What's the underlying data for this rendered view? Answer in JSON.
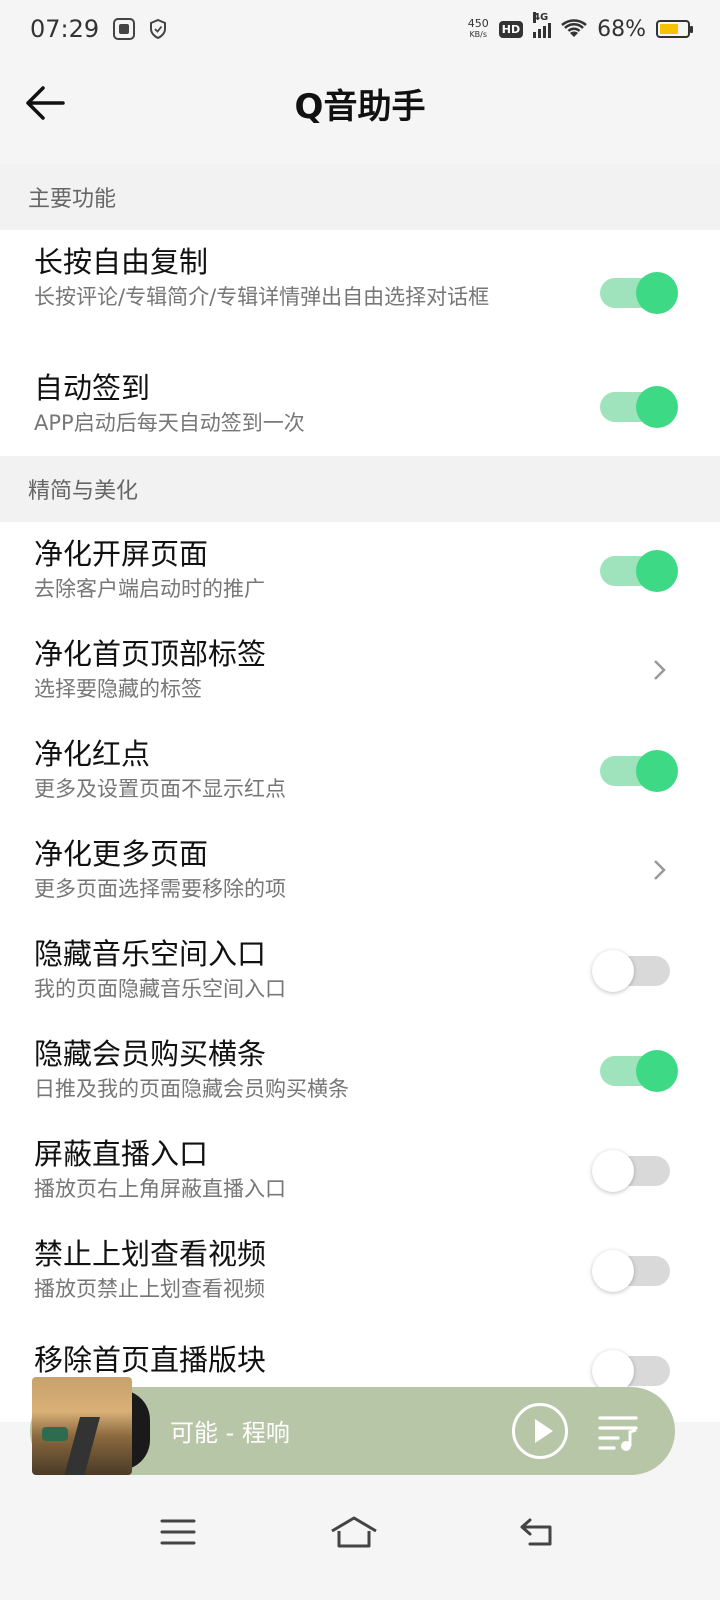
{
  "status_bar": {
    "time": "07:29",
    "net_speed_top": "450",
    "net_speed_bottom": "KB/s",
    "hd": "HD",
    "network": "4G",
    "battery": "68%",
    "battery_level": 0.68,
    "battery_color": "#f7c200"
  },
  "header": {
    "title": "Q音助手",
    "back_icon": "arrow-left-icon"
  },
  "sections": [
    {
      "label": "主要功能",
      "items": [
        {
          "title": "长按自由复制",
          "desc": "长按评论/专辑简介/专辑详情弹出自由选择对话框",
          "control": "toggle",
          "on": true
        },
        {
          "title": "自动签到",
          "desc": "APP启动后每天自动签到一次",
          "control": "toggle",
          "on": true
        }
      ]
    },
    {
      "label": "精简与美化",
      "items": [
        {
          "title": "净化开屏页面",
          "desc": "去除客户端启动时的推广",
          "control": "toggle",
          "on": true
        },
        {
          "title": "净化首页顶部标签",
          "desc": "选择要隐藏的标签",
          "control": "chevron"
        },
        {
          "title": "净化红点",
          "desc": "更多及设置页面不显示红点",
          "control": "toggle",
          "on": true
        },
        {
          "title": "净化更多页面",
          "desc": "更多页面选择需要移除的项",
          "control": "chevron"
        },
        {
          "title": "隐藏音乐空间入口",
          "desc": "我的页面隐藏音乐空间入口",
          "control": "toggle",
          "on": false
        },
        {
          "title": "隐藏会员购买横条",
          "desc": "日推及我的页面隐藏会员购买横条",
          "control": "toggle",
          "on": true
        },
        {
          "title": "屏蔽直播入口",
          "desc": "播放页右上角屏蔽直播入口",
          "control": "toggle",
          "on": false
        },
        {
          "title": "禁止上划查看视频",
          "desc": "播放页禁止上划查看视频",
          "control": "toggle",
          "on": false
        },
        {
          "title": "移除首页直播版块",
          "desc": "",
          "control": "toggle",
          "on": false
        }
      ]
    }
  ],
  "player": {
    "song": "可能 - 程响",
    "bar_color": "#b7c6a7",
    "play_icon": "play-icon",
    "playlist_icon": "playlist-icon"
  },
  "navbar": {
    "menu_icon": "menu-icon",
    "home_icon": "home-icon",
    "back_icon": "back-icon"
  },
  "colors": {
    "toggle_on_track": "#9fe3bd",
    "toggle_on_knob": "#3ed985",
    "toggle_off_track": "#d9d9d9"
  }
}
